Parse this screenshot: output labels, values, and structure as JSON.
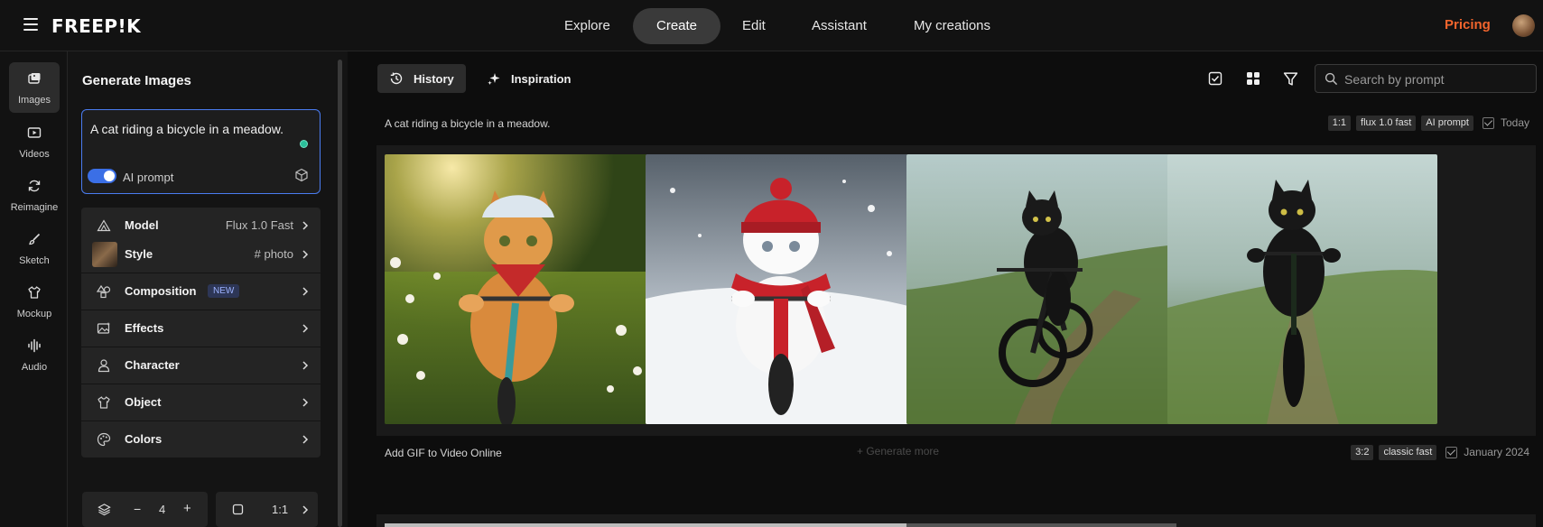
{
  "topbar": {
    "logo": "FREEP!K",
    "nav": [
      "Explore",
      "Create",
      "Edit",
      "Assistant",
      "My creations"
    ],
    "active_nav": "Create",
    "pricing": "Pricing"
  },
  "rail": {
    "items": [
      {
        "label": "Images",
        "icon": "image-icon",
        "active": true
      },
      {
        "label": "Videos",
        "icon": "video-icon"
      },
      {
        "label": "Reimagine",
        "icon": "refresh-icon"
      },
      {
        "label": "Sketch",
        "icon": "brush-icon"
      },
      {
        "label": "Mockup",
        "icon": "shirt-icon"
      },
      {
        "label": "Audio",
        "icon": "audio-wave-icon"
      }
    ]
  },
  "panel": {
    "title": "Generate Images",
    "prompt": "A cat riding a bicycle in a meadow.",
    "ai_prompt_label": "AI prompt",
    "ai_prompt_enabled": true,
    "model": {
      "label": "Model",
      "value": "Flux 1.0 Fast"
    },
    "style": {
      "label": "Style",
      "value": "# photo"
    },
    "composition": {
      "label": "Composition",
      "badge": "NEW"
    },
    "effects": {
      "label": "Effects"
    },
    "character": {
      "label": "Character"
    },
    "object": {
      "label": "Object"
    },
    "colors": {
      "label": "Colors"
    },
    "count": "4",
    "count_minus": "−",
    "count_plus": "+",
    "aspect": "1:1"
  },
  "main": {
    "tabs": [
      {
        "label": "History",
        "icon": "history-icon",
        "active": true
      },
      {
        "label": "Inspiration",
        "icon": "sparkle-icon"
      }
    ],
    "search_placeholder": "Search by prompt",
    "groups": [
      {
        "prompt": "A cat riding a bicycle in a meadow.",
        "tags": [
          "1:1",
          "flux 1.0 fast",
          "AI prompt"
        ],
        "date": "Today",
        "images": [
          "ginger-cat-helmet-bicycle-meadow",
          "white-cat-red-hat-snow-bicycle",
          "black-cat-mountain-bike-trail",
          "black-cat-bike-foggy-field"
        ]
      },
      {
        "prompt": "Add GIF to Video Online",
        "tags": [
          "3:2",
          "classic fast"
        ],
        "date": "January 2024"
      }
    ],
    "generate_more": "+  Generate more"
  }
}
